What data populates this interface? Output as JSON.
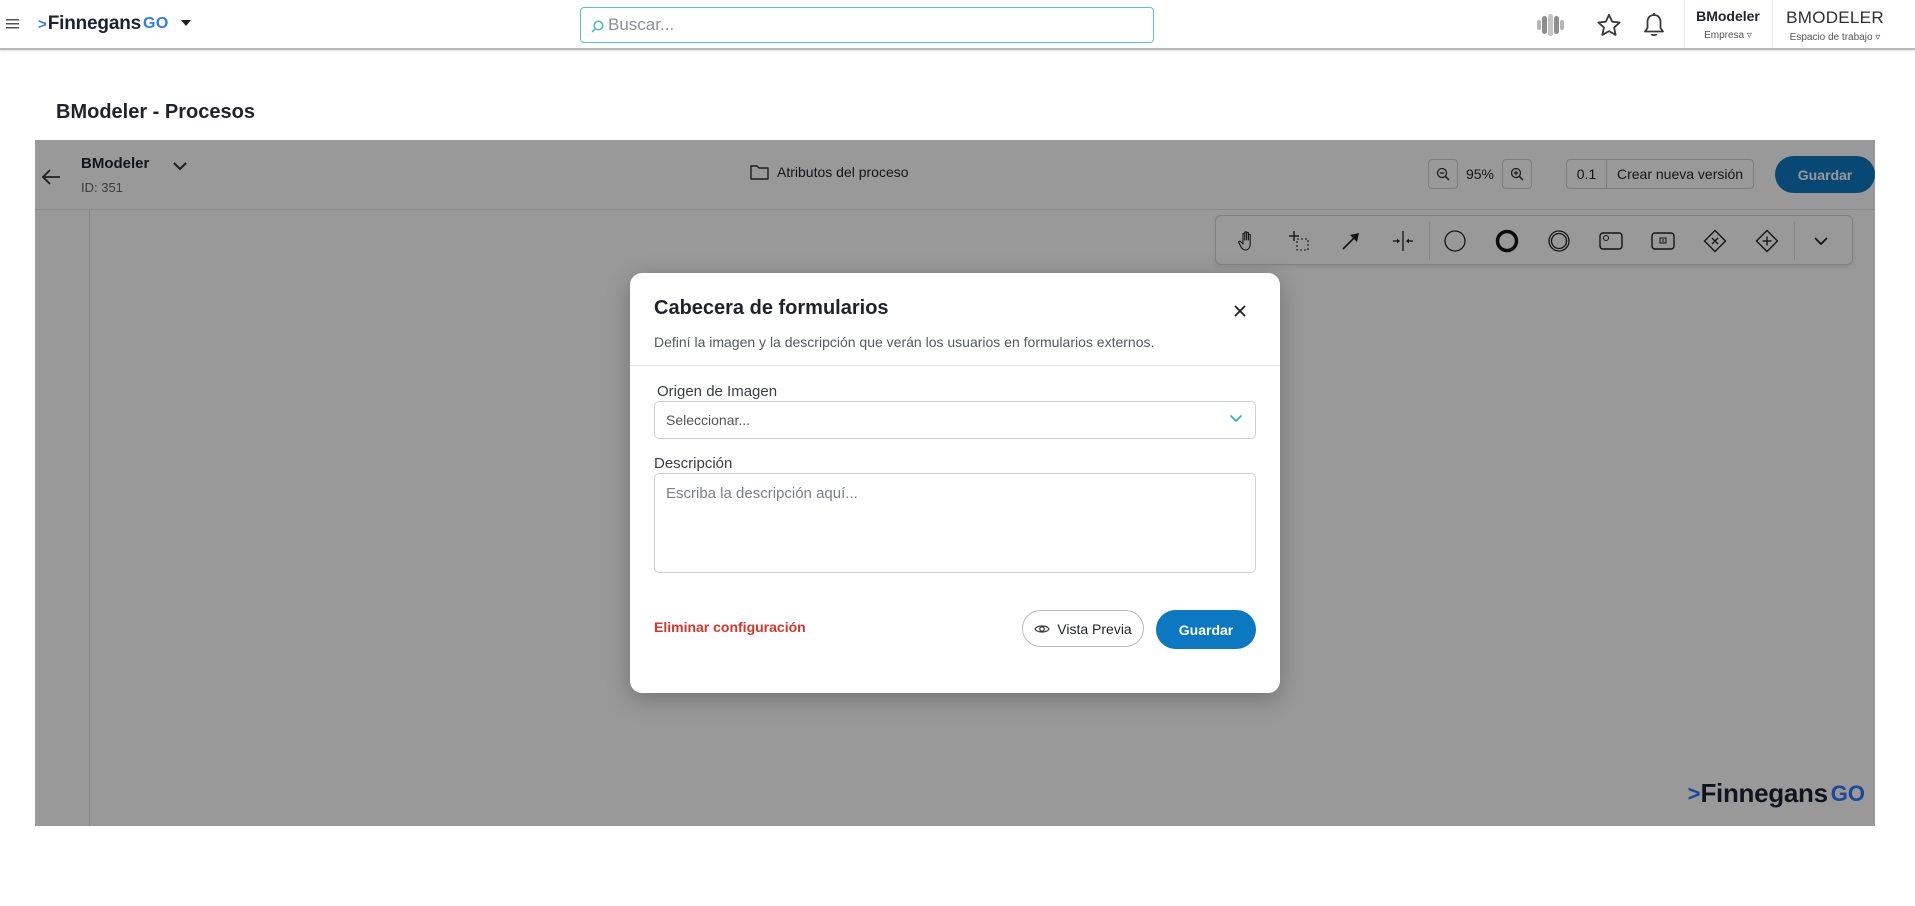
{
  "header": {
    "brand_name": "Finnegans",
    "brand_suffix": "GO",
    "search_placeholder": "Buscar...",
    "company_name": "BModeler",
    "company_label": "Empresa",
    "workspace_name": "BMODELER",
    "workspace_label": "Espacio de trabajo"
  },
  "page": {
    "title": "BModeler - Procesos"
  },
  "editor": {
    "process_name": "BModeler",
    "process_id": "ID: 351",
    "attributes_label": "Atributos del proceso",
    "zoom": "95%",
    "version": "0.1",
    "new_version_label": "Crear nueva versión",
    "save_label": "Guardar",
    "palette_tools": [
      "hand-tool",
      "lasso-tool",
      "connect-tool",
      "space-tool",
      "start-event",
      "end-event",
      "intermediate-event",
      "task",
      "subprocess",
      "exclusive-gateway",
      "parallel-gateway",
      "more"
    ]
  },
  "watermark": {
    "name": "Finnegans",
    "suffix": "GO"
  },
  "modal": {
    "title": "Cabecera de formularios",
    "subtitle": "Definí la imagen y la descripción que verán los usuarios en formularios externos.",
    "image_source_label": "Origen de Imagen",
    "image_source_placeholder": "Seleccionar...",
    "description_label": "Descripción",
    "description_placeholder": "Escriba la descripción aquí...",
    "delete_label": "Eliminar configuración",
    "preview_label": "Vista Previa",
    "save_label": "Guardar"
  },
  "colors": {
    "primary": "#0d78c2",
    "danger": "#d6342c",
    "brand": "#2e79ff",
    "search_border": "#54c5d4"
  }
}
